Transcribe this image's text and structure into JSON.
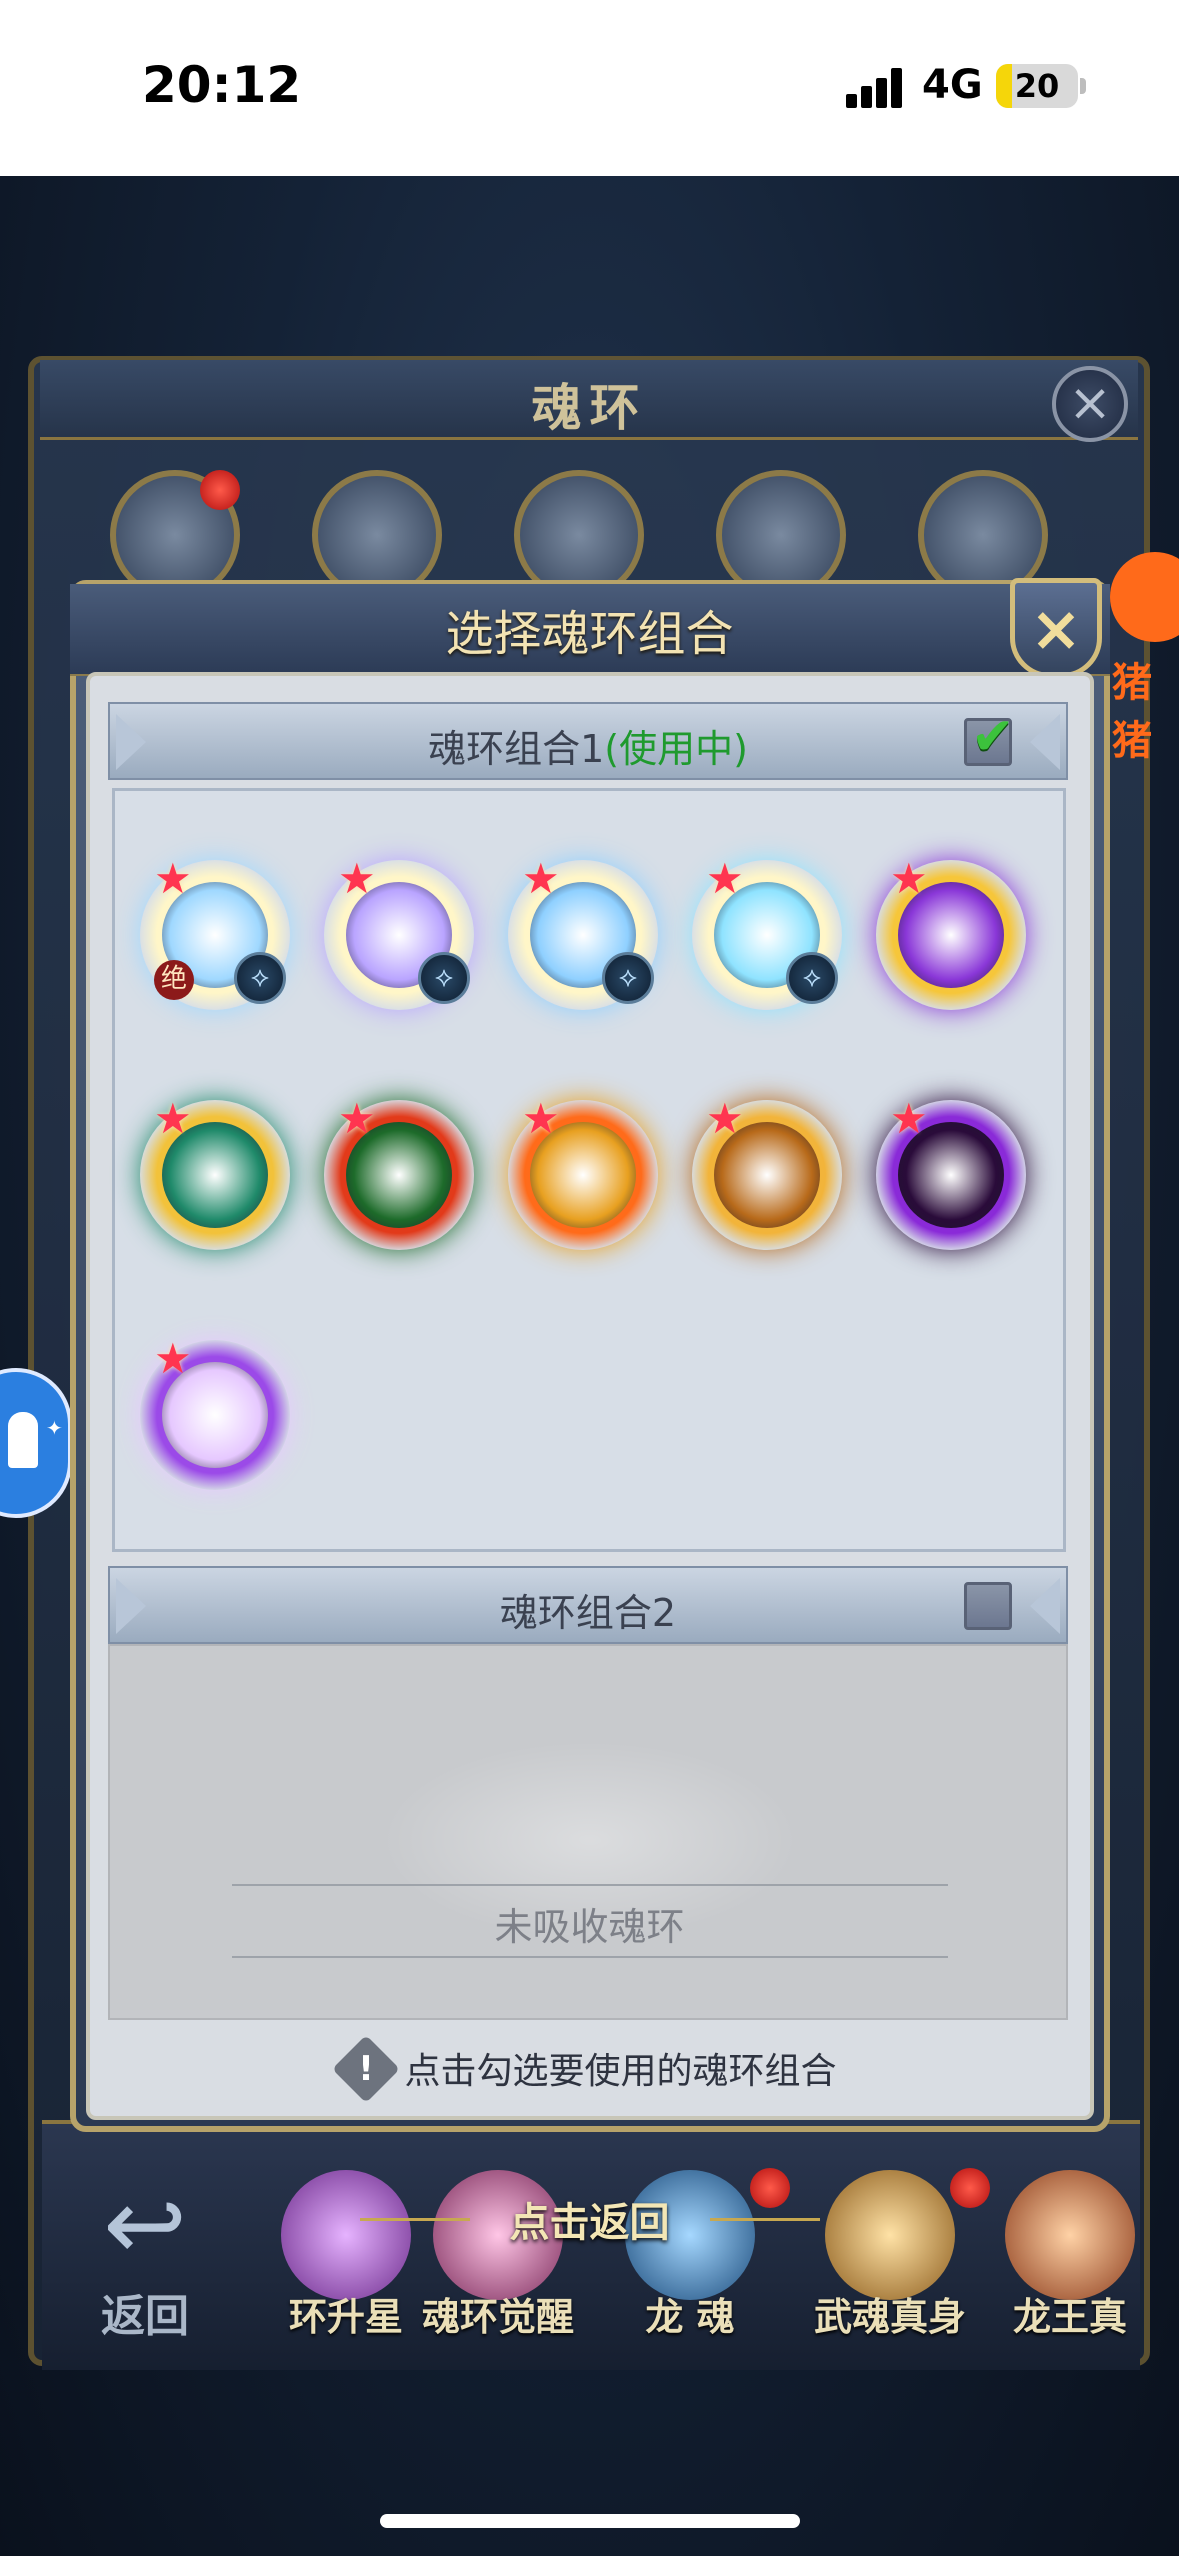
{
  "status_bar": {
    "time": "20:12",
    "network": "4G",
    "battery": "20",
    "battery_level_percent": 20
  },
  "background_window": {
    "title": "魂环",
    "close_icon": "×"
  },
  "modal": {
    "title": "选择魂环组合",
    "close_icon": "×",
    "group1": {
      "title": "魂环组合1",
      "status": "(使用中)",
      "checked": true,
      "rings": [
        {
          "name": "soul-ring-1",
          "colors": [
            "#fff6c8",
            "#9fd8ff"
          ],
          "badge": "⟡",
          "mark": "绝"
        },
        {
          "name": "soul-ring-2",
          "colors": [
            "#fff6c8",
            "#b9a4ff"
          ],
          "badge": "⟡",
          "mark": ""
        },
        {
          "name": "soul-ring-3",
          "colors": [
            "#fff6c8",
            "#8fd0ff"
          ],
          "badge": "⟡",
          "mark": ""
        },
        {
          "name": "soul-ring-4",
          "colors": [
            "#fff6c8",
            "#8fe3ff"
          ],
          "badge": "⟡",
          "mark": ""
        },
        {
          "name": "soul-ring-5",
          "colors": [
            "#f6c63a",
            "#8a37d8"
          ],
          "badge": "",
          "mark": ""
        },
        {
          "name": "soul-ring-6",
          "colors": [
            "#f2c23a",
            "#1f8a6a"
          ],
          "badge": "",
          "mark": ""
        },
        {
          "name": "soul-ring-7",
          "colors": [
            "#e23a1a",
            "#1d6b2a"
          ],
          "badge": "",
          "mark": ""
        },
        {
          "name": "soul-ring-8",
          "colors": [
            "#ff6b1a",
            "#e8a020"
          ],
          "badge": "",
          "mark": ""
        },
        {
          "name": "soul-ring-9",
          "colors": [
            "#f2b43a",
            "#b86a1a"
          ],
          "badge": "",
          "mark": ""
        },
        {
          "name": "soul-ring-10",
          "colors": [
            "#8a2ad8",
            "#2a0b3a"
          ],
          "badge": "",
          "mark": ""
        },
        {
          "name": "soul-ring-11",
          "colors": [
            "#9b4ae8",
            "#e6c8ff"
          ],
          "badge": "",
          "mark": ""
        }
      ]
    },
    "group2": {
      "title": "魂环组合2",
      "checked": false,
      "empty_text": "未吸收魂环"
    },
    "hint": "点击勾选要使用的魂环组合"
  },
  "bottom_nav": {
    "back_label": "返回",
    "tap_return": "点击返回",
    "items": [
      {
        "label": "环升星",
        "color": "#b45ad6"
      },
      {
        "label": "魂环觉醒",
        "color": "#d86aa8"
      },
      {
        "label": "龙 魂",
        "color": "#3a8ad8"
      },
      {
        "label": "武魂真身",
        "color": "#d8a23a"
      },
      {
        "label": "龙王真",
        "color": "#d8823a"
      }
    ]
  },
  "side_widgets": {
    "right_badge_text": "猪猪"
  }
}
